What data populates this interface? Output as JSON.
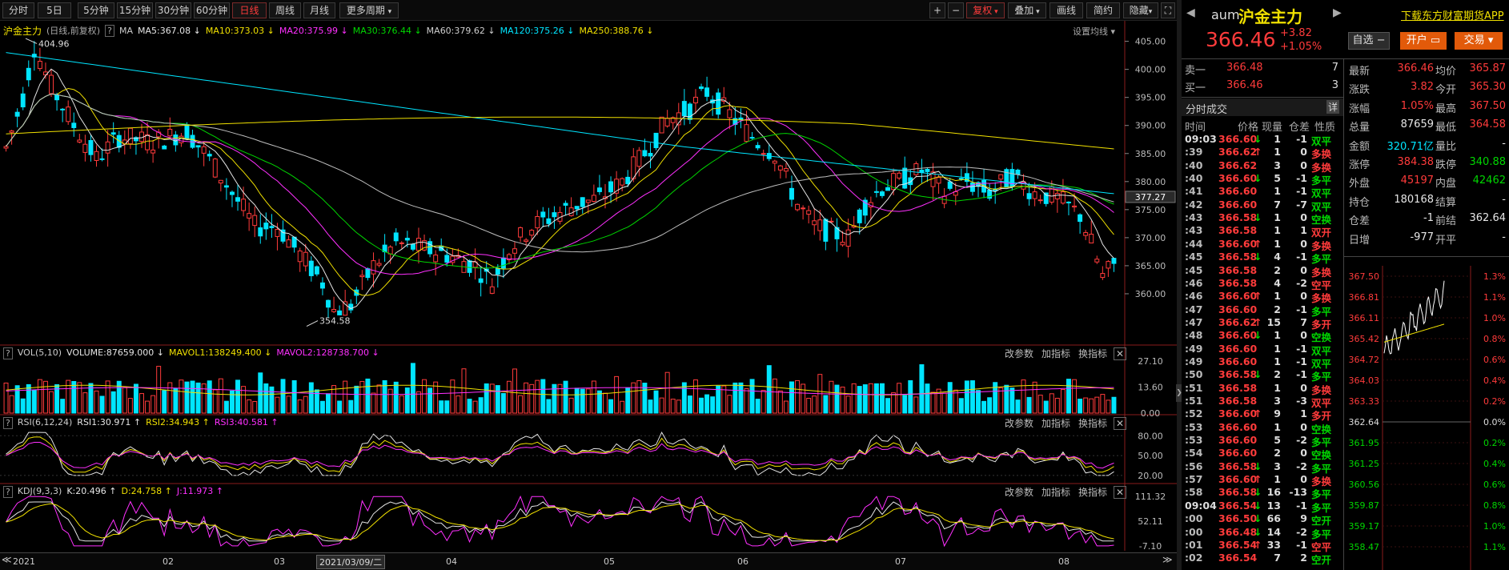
{
  "toolbar": {
    "periods": [
      "分时",
      "5日",
      "5分钟",
      "15分钟",
      "30分钟",
      "60分钟",
      "日线",
      "周线",
      "月线",
      "更多周期"
    ],
    "active": "日线",
    "buttons": [
      "+",
      "−",
      "复权",
      "叠加",
      "画线",
      "简约",
      "隐藏"
    ]
  },
  "legend": {
    "symbol": "沪金主力",
    "mode": "(日线,前复权)",
    "ma": [
      {
        "label": "MA5:",
        "value": "367.08",
        "dir": "↓",
        "color": "#e6e6e6"
      },
      {
        "label": "MA10:",
        "value": "373.03",
        "dir": "↓",
        "color": "#f0e000"
      },
      {
        "label": "MA20:",
        "value": "375.99",
        "dir": "↓",
        "color": "#ff30ff"
      },
      {
        "label": "MA30:",
        "value": "376.44",
        "dir": "↓",
        "color": "#00d600"
      },
      {
        "label": "MA60:",
        "value": "379.62",
        "dir": "↓",
        "color": "#cfcfcf"
      },
      {
        "label": "MA120:",
        "value": "375.26",
        "dir": "↓",
        "color": "#00e5ff"
      },
      {
        "label": "MA250:",
        "value": "388.76",
        "dir": "↓",
        "color": "#f0e000"
      }
    ],
    "settings": "设置均线"
  },
  "main_chart": {
    "high_label": "404.96",
    "low_label": "354.58",
    "current_tag": "377.27",
    "yticks": [
      "405.00",
      "400.00",
      "395.00",
      "390.00",
      "385.00",
      "380.00",
      "375.00",
      "370.00",
      "365.00",
      "360.00"
    ]
  },
  "vol": {
    "title": "VOL(5,10)",
    "items": [
      {
        "t": "VOLUME:87659.000",
        "d": "↓",
        "c": "#e6e6e6"
      },
      {
        "t": "MAVOL1:138249.400",
        "d": "↓",
        "c": "#f0e000"
      },
      {
        "t": "MAVOL2:128738.700",
        "d": "↓",
        "c": "#ff30ff"
      }
    ],
    "yticks": [
      "27.10",
      "13.60",
      "0.00"
    ],
    "actions": [
      "改参数",
      "加指标",
      "换指标"
    ]
  },
  "rsi": {
    "title": "RSI(6,12,24)",
    "items": [
      {
        "t": "RSI1:30.971",
        "d": "↑",
        "c": "#e6e6e6"
      },
      {
        "t": "RSI2:34.943",
        "d": "↑",
        "c": "#f0e000"
      },
      {
        "t": "RSI3:40.581",
        "d": "↑",
        "c": "#ff30ff"
      }
    ],
    "yticks": [
      "80.00",
      "50.00",
      "20.00"
    ],
    "actions": [
      "改参数",
      "加指标",
      "换指标"
    ]
  },
  "kdj": {
    "title": "KDJ(9,3,3)",
    "items": [
      {
        "t": "K:20.496",
        "d": "↑",
        "c": "#e6e6e6"
      },
      {
        "t": "D:24.758",
        "d": "↑",
        "c": "#f0e000"
      },
      {
        "t": "J:11.973",
        "d": "↑",
        "c": "#ff30ff"
      }
    ],
    "yticks": [
      "111.32",
      "52.11",
      "-7.10"
    ],
    "actions": [
      "改参数",
      "加指标",
      "换指标"
    ]
  },
  "xaxis": {
    "labels": [
      "2021",
      "02",
      "03",
      "04",
      "05",
      "06",
      "07",
      "08"
    ],
    "cursor": "2021/03/09/二"
  },
  "quote": {
    "code": "aum",
    "name": "沪金主力",
    "price": "366.46",
    "change": "+3.82",
    "pct": "+1.05%",
    "download": "下载东方财富期货APP",
    "btn_fav": "自选 −",
    "btn_open": "开户",
    "btn_trade": "交易"
  },
  "orderbook": {
    "sell": {
      "label": "卖一",
      "price": "366.48",
      "vol": "7"
    },
    "buy": {
      "label": "买一",
      "price": "366.46",
      "vol": "3"
    }
  },
  "stats": [
    {
      "l1": "最新",
      "v1": "366.46",
      "c1": "red",
      "l2": "均价",
      "v2": "365.87",
      "c2": "red"
    },
    {
      "l1": "涨跌",
      "v1": "3.82",
      "c1": "red",
      "l2": "今开",
      "v2": "365.30",
      "c2": "red"
    },
    {
      "l1": "涨幅",
      "v1": "1.05%",
      "c1": "red",
      "l2": "最高",
      "v2": "367.50",
      "c2": "red"
    },
    {
      "l1": "总量",
      "v1": "87659",
      "c1": "wht",
      "l2": "最低",
      "v2": "364.58",
      "c2": "red"
    },
    {
      "l1": "金额",
      "v1": "320.71亿",
      "c1": "cyan",
      "l2": "量比",
      "v2": "-",
      "c2": "wht"
    },
    {
      "l1": "涨停",
      "v1": "384.38",
      "c1": "red",
      "l2": "跌停",
      "v2": "340.88",
      "c2": "grn"
    },
    {
      "l1": "外盘",
      "v1": "45197",
      "c1": "red",
      "l2": "内盘",
      "v2": "42462",
      "c2": "grn"
    },
    {
      "l1": "持仓",
      "v1": "180168",
      "c1": "wht",
      "l2": "结算",
      "v2": "-",
      "c2": "wht"
    },
    {
      "l1": "仓差",
      "v1": "-1",
      "c1": "wht",
      "l2": "前结",
      "v2": "362.64",
      "c2": "wht"
    },
    {
      "l1": "日增",
      "v1": "-977",
      "c1": "wht",
      "l2": "开平",
      "v2": "-",
      "c2": "wht"
    }
  ],
  "ticks": {
    "title": "分时成交",
    "detail": "详",
    "headers": [
      "时间",
      "价格",
      "现量",
      "仓差",
      "性质"
    ],
    "rows": [
      [
        "09:03",
        "366.60",
        "↓",
        "1",
        "-1",
        "双平",
        "g"
      ],
      [
        ":39",
        "366.62",
        "↑",
        "1",
        "0",
        "多换",
        "r"
      ],
      [
        ":40",
        "366.62",
        "",
        "3",
        "0",
        "多换",
        "r"
      ],
      [
        ":40",
        "366.60",
        "↓",
        "5",
        "-1",
        "多平",
        "g"
      ],
      [
        ":41",
        "366.60",
        "",
        "1",
        "-1",
        "双平",
        "g"
      ],
      [
        ":42",
        "366.60",
        "",
        "7",
        "-7",
        "双平",
        "g"
      ],
      [
        ":43",
        "366.58",
        "↓",
        "1",
        "0",
        "空换",
        "g"
      ],
      [
        ":43",
        "366.58",
        "",
        "1",
        "1",
        "双开",
        "r"
      ],
      [
        ":44",
        "366.60",
        "↑",
        "1",
        "0",
        "多换",
        "r"
      ],
      [
        ":45",
        "366.58",
        "↓",
        "4",
        "-1",
        "多平",
        "g"
      ],
      [
        ":45",
        "366.58",
        "",
        "2",
        "0",
        "多换",
        "r"
      ],
      [
        ":46",
        "366.58",
        "",
        "4",
        "-2",
        "空平",
        "r"
      ],
      [
        ":46",
        "366.60",
        "↑",
        "1",
        "0",
        "多换",
        "r"
      ],
      [
        ":47",
        "366.60",
        "",
        "2",
        "-1",
        "多平",
        "g"
      ],
      [
        ":47",
        "366.62",
        "↑",
        "15",
        "7",
        "多开",
        "r"
      ],
      [
        ":48",
        "366.60",
        "↓",
        "1",
        "0",
        "空换",
        "g"
      ],
      [
        ":49",
        "366.60",
        "",
        "1",
        "-1",
        "双平",
        "g"
      ],
      [
        ":49",
        "366.60",
        "",
        "1",
        "-1",
        "双平",
        "g"
      ],
      [
        ":50",
        "366.58",
        "↓",
        "2",
        "-1",
        "多平",
        "g"
      ],
      [
        ":51",
        "366.58",
        "",
        "1",
        "0",
        "多换",
        "r"
      ],
      [
        ":51",
        "366.58",
        "",
        "3",
        "-3",
        "双平",
        "r"
      ],
      [
        ":52",
        "366.60",
        "↑",
        "9",
        "1",
        "多开",
        "r"
      ],
      [
        ":53",
        "366.60",
        "",
        "1",
        "0",
        "空换",
        "g"
      ],
      [
        ":53",
        "366.60",
        "",
        "5",
        "-2",
        "多平",
        "g"
      ],
      [
        ":54",
        "366.60",
        "",
        "2",
        "0",
        "空换",
        "g"
      ],
      [
        ":56",
        "366.58",
        "↓",
        "3",
        "-2",
        "多平",
        "g"
      ],
      [
        ":57",
        "366.60",
        "↑",
        "1",
        "0",
        "多换",
        "r"
      ],
      [
        ":58",
        "366.58",
        "↓",
        "16",
        "-13",
        "多平",
        "g"
      ],
      [
        "09:04",
        "366.54",
        "↓",
        "13",
        "-1",
        "多平",
        "g"
      ],
      [
        ":00",
        "366.50",
        "↓",
        "66",
        "9",
        "空开",
        "g"
      ],
      [
        ":00",
        "366.48",
        "↓",
        "14",
        "-2",
        "多平",
        "g"
      ],
      [
        ":01",
        "366.54",
        "↑",
        "33",
        "-1",
        "空平",
        "r"
      ],
      [
        ":02",
        "366.54",
        "",
        "7",
        "2",
        "空开",
        "g"
      ]
    ]
  },
  "mini": {
    "left": [
      "367.50",
      "366.81",
      "366.11",
      "365.42",
      "364.72",
      "364.03",
      "363.33",
      "362.64",
      "361.95",
      "361.25",
      "360.56",
      "359.87",
      "359.17",
      "358.47"
    ],
    "right": [
      "1.3%",
      "1.1%",
      "1.0%",
      "0.8%",
      "0.6%",
      "0.4%",
      "0.2%",
      "0.0%",
      "0.2%",
      "0.4%",
      "0.6%",
      "0.8%",
      "1.0%",
      "1.1%"
    ]
  }
}
